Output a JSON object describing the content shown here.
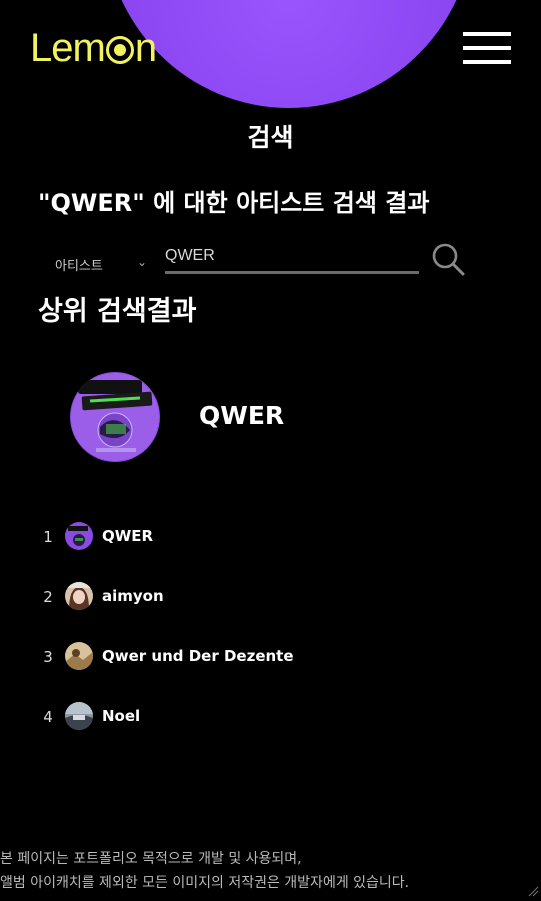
{
  "header": {
    "logo_text_before": "Lem",
    "logo_text_after": "n",
    "menu_icon": "hamburger-icon"
  },
  "page": {
    "title": "검색",
    "result_heading": "\"QWER\" 에 대한 아티스트 검색 결과"
  },
  "search": {
    "category": "아티스트",
    "query": "QWER",
    "icon": "search-icon"
  },
  "top_result": {
    "heading": "상위 검색결과",
    "artist_name": "QWER"
  },
  "artists": [
    {
      "rank": "1",
      "name": "QWER"
    },
    {
      "rank": "2",
      "name": "aimyon"
    },
    {
      "rank": "3",
      "name": "Qwer und Der Dezente"
    },
    {
      "rank": "4",
      "name": "Noel"
    }
  ],
  "footer": {
    "line1": "본 페이지는 포트폴리오 목적으로 개발 및 사용되며,",
    "line2": "앨범 아이캐치를 제외한 모든 이미지의 저작권은 개발자에게 있습니다."
  },
  "colors": {
    "background": "#000000",
    "accent_purple": "#8a45f0",
    "logo_yellow": "#f2f25c"
  }
}
